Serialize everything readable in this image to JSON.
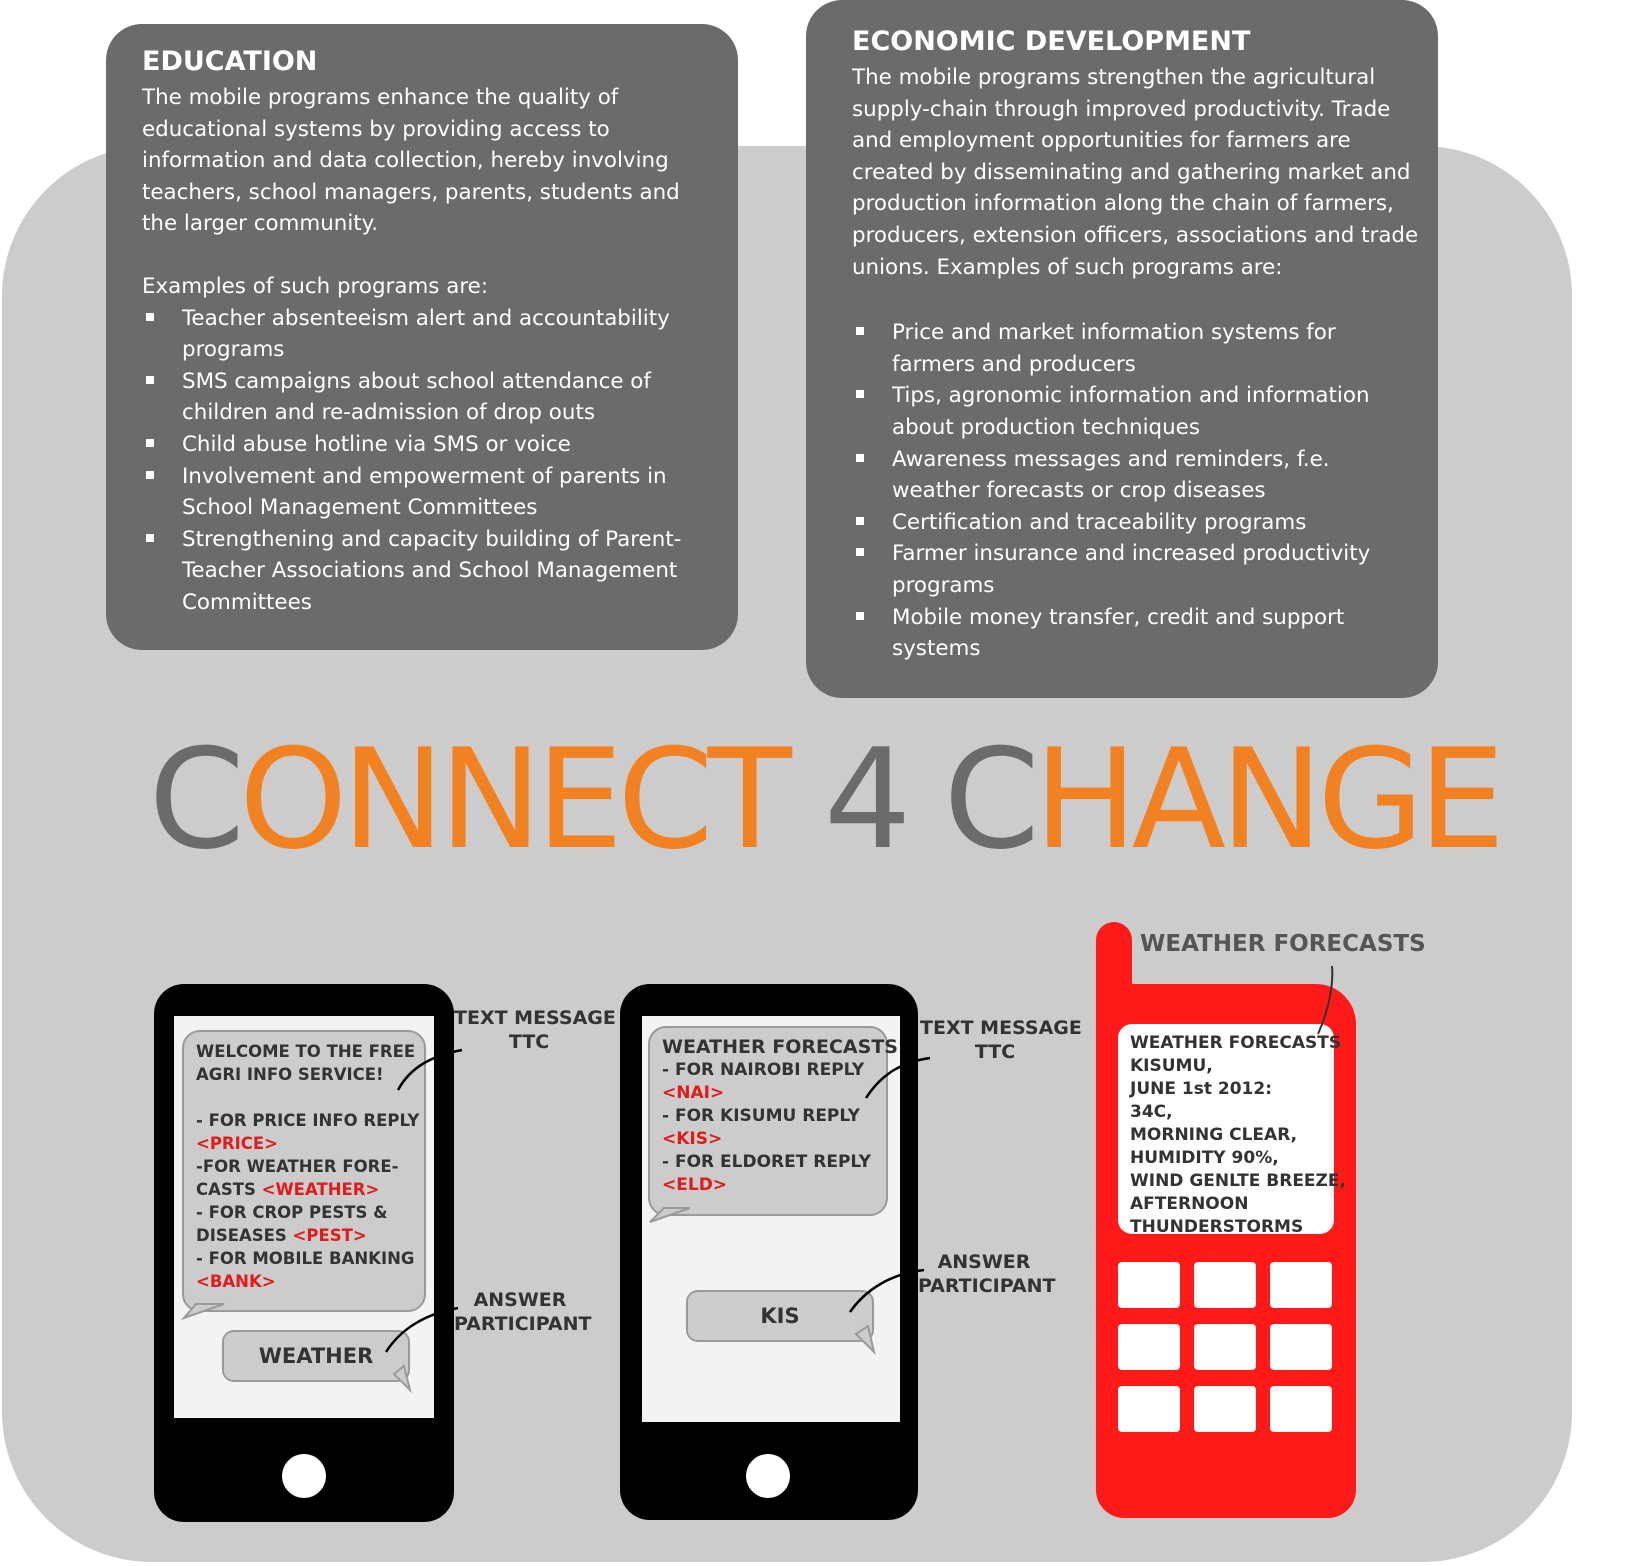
{
  "education": {
    "title": "EDUCATION",
    "intro": "The mobile programs enhance the quality of educational systems by providing access to information and data collection, hereby involving teachers, school managers, parents, students and the larger community.",
    "examples_label": "Examples of such programs are:",
    "items": [
      "Teacher absenteeism alert and accountability programs",
      "SMS campaigns about school attendance of children and re-admission of drop outs",
      "Child abuse hotline via SMS or voice",
      "Involvement and empowerment of parents in School Management Committees",
      "Strengthening and capacity building of Parent-Teacher Associations and School Management Committees"
    ]
  },
  "economic": {
    "title": "ECONOMIC DEVELOPMENT",
    "intro": "The mobile programs strengthen the agricultural supply-chain through improved productivity. Trade and employment opportunities for farmers are created by disseminating and gathering market and production information along the chain of farmers, producers, extension officers, associations and trade unions. Examples of such programs are:",
    "items": [
      "Price and market information systems for farmers and producers",
      "Tips,  agronomic information and information about production techniques",
      "Awareness messages and reminders, f.e. weather forecasts or crop diseases",
      "Certification and traceability programs",
      "Farmer insurance and increased productivity programs",
      "Mobile money transfer, credit and support systems"
    ]
  },
  "headline": {
    "c1": "C",
    "onnect": "ONNECT",
    "four": "4",
    "c2": "C",
    "hange": "HANGE"
  },
  "phone1": {
    "msg": {
      "l1": "WELCOME TO THE FREE",
      "l2": "AGRI INFO SERVICE!",
      "l3": "- FOR PRICE INFO REPLY",
      "l4": "<PRICE>",
      "l5": "-FOR WEATHER FORE-",
      "l6a": "CASTS ",
      "l6b": "<WEATHER>",
      "l7": "- FOR CROP PESTS &",
      "l8a": "DISEASES ",
      "l8b": "<PEST>",
      "l9": "- FOR MOBILE BANKING",
      "l10": "<BANK>"
    },
    "answer": "WEATHER",
    "label_text_1": "TEXT MESSAGE",
    "label_text_2": "TTC",
    "label_answer_1": "ANSWER",
    "label_answer_2": "PARTICIPANT"
  },
  "phone2": {
    "msg": {
      "l1": "WEATHER FORECASTS",
      "l2": "- FOR NAIROBI REPLY",
      "l3": "<NAI>",
      "l4": "- FOR KISUMU REPLY",
      "l5": "<KIS>",
      "l6": "- FOR ELDORET REPLY",
      "l7": "<ELD>"
    },
    "answer": "KIS",
    "label_text_1": "TEXT MESSAGE",
    "label_text_2": "TTC",
    "label_answer_1": "ANSWER",
    "label_answer_2": "PARTICIPANT"
  },
  "phone3": {
    "label": "WEATHER FORECASTS",
    "screen": [
      "WEATHER FORECASTS",
      "KISUMU,",
      "JUNE 1st 2012:",
      "34C,",
      "MORNING CLEAR,",
      "HUMIDITY 90%,",
      "WIND GENLTE BREEZE,",
      "AFTERNOON",
      "THUNDERSTORMS"
    ]
  },
  "colors": {
    "orange": "#f28122",
    "dark_gray": "#6b6b6b",
    "panel_gray": "#cccccc",
    "red": "#ff1a1a",
    "reply_red": "#e01b1b"
  }
}
